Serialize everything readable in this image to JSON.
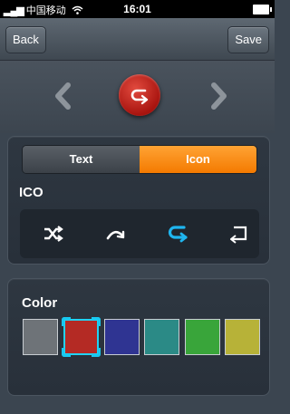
{
  "status_bar": {
    "signal": "▂▄▆",
    "carrier": "中国移动",
    "wifi": "wifi-icon",
    "time": "16:01",
    "battery": "battery-icon"
  },
  "nav": {
    "back_label": "Back",
    "save_label": "Save"
  },
  "preview": {
    "prev_icon": "chevron-left-icon",
    "next_icon": "chevron-right-icon",
    "current_icon": "loop-arrow-icon",
    "current_color": "#c51f18"
  },
  "mode_tabs": {
    "text_label": "Text",
    "icon_label": "Icon",
    "selected": "Icon"
  },
  "icon_section": {
    "title": "ICO",
    "icons": [
      "shuffle-icon",
      "redo-arc-icon",
      "loop-arrow-icon",
      "return-icon"
    ],
    "selected_index": 2,
    "selected_color": "#1fb5ef"
  },
  "color_section": {
    "title": "Color",
    "swatches": [
      "#6e7378",
      "#b42a24",
      "#2f3492",
      "#2b8a86",
      "#39a53a",
      "#b7b238"
    ],
    "selected_index": 1
  }
}
